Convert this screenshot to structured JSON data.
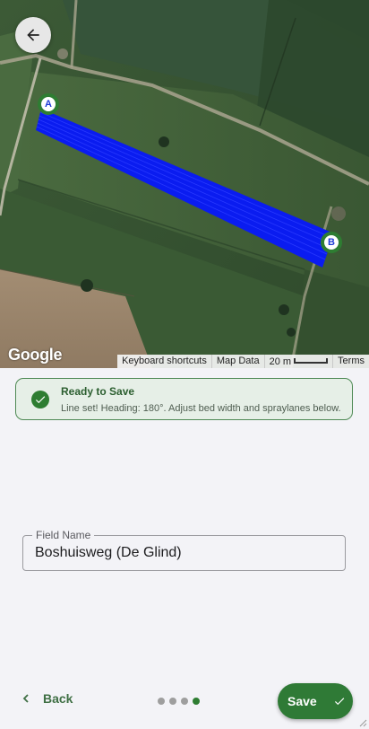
{
  "map": {
    "google_logo": "Google",
    "attribution": [
      "Keyboard shortcuts",
      "Map Data"
    ],
    "scale_label": "20 m",
    "terms": "Terms",
    "marker_a": "A",
    "marker_b": "B",
    "line_color": "#0a1cf0",
    "icons": {
      "back": "arrow-left-icon"
    }
  },
  "status": {
    "title": "Ready to Save",
    "message": "Line set! Heading: 180°. Adjust bed width and spraylanes below.",
    "icon": "check-circle-icon",
    "color": "#2e7d32"
  },
  "field": {
    "label": "Field Name",
    "value": "Boshuisweg (De Glind)"
  },
  "footer": {
    "back_label": "Back",
    "save_label": "Save",
    "steps_total": 4,
    "current_step": 4,
    "accent": "#2f7a36"
  }
}
